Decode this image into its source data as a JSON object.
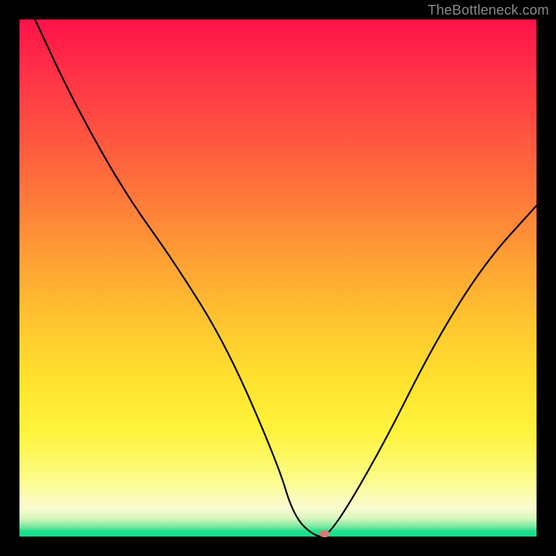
{
  "watermark": "TheBottleneck.com",
  "chart_data": {
    "type": "line",
    "title": "",
    "xlabel": "",
    "ylabel": "",
    "xlim": [
      0,
      100
    ],
    "ylim": [
      0,
      100
    ],
    "grid": false,
    "series": [
      {
        "name": "bottleneck-curve",
        "x": [
          3,
          10,
          20,
          30,
          40,
          50,
          53,
          57,
          60,
          70,
          80,
          90,
          100
        ],
        "y": [
          100,
          85,
          67,
          53,
          37,
          14,
          4,
          0,
          0,
          17,
          37,
          53,
          64
        ]
      }
    ],
    "marker": {
      "x": 59,
      "y": 0.5,
      "name": "optimal-point"
    },
    "background_gradient": {
      "top": "#ff1249",
      "mid": "#ffe22e",
      "bottom": "#12dd8a"
    }
  }
}
